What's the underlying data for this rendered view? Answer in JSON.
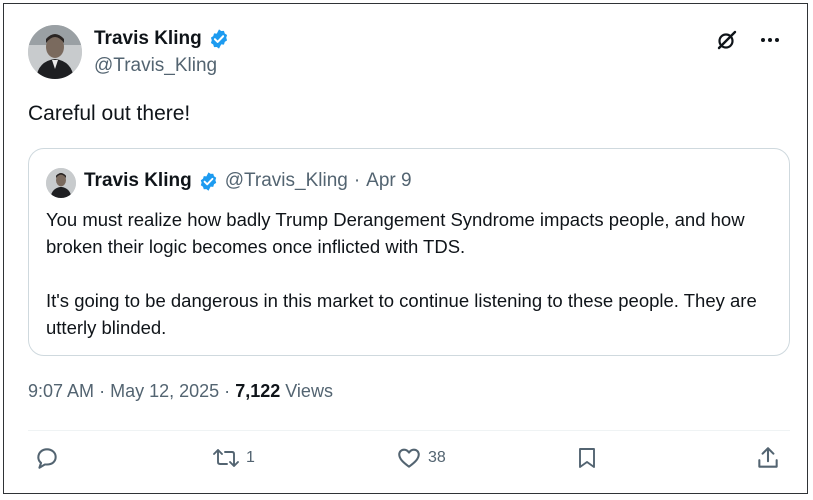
{
  "tweet": {
    "author": {
      "name": "Travis Kling",
      "handle": "@Travis_Kling",
      "verified_color": "#1d9bf0"
    },
    "text": "Careful out there!",
    "quoted": {
      "name": "Travis Kling",
      "handle": "@Travis_Kling",
      "separator": "·",
      "date": "Apr 9",
      "paragraphs": [
        "You must realize how badly Trump Derangement Syndrome impacts people, and how broken their logic becomes once inflicted with TDS.",
        "It's going to be dangerous in this market to continue listening to these people. They are utterly blinded."
      ]
    },
    "meta": {
      "time": "9:07 AM",
      "sep1": "·",
      "date": "May 12, 2025",
      "sep2": "·",
      "views_count": "7,122",
      "views_label": "Views"
    },
    "actions": {
      "reply_icon": "reply-icon",
      "retweet_count": "1",
      "like_count": "38",
      "bookmark_icon": "bookmark-icon",
      "share_icon": "share-icon"
    },
    "top_icons": [
      "grok-icon",
      "more-icon"
    ]
  }
}
